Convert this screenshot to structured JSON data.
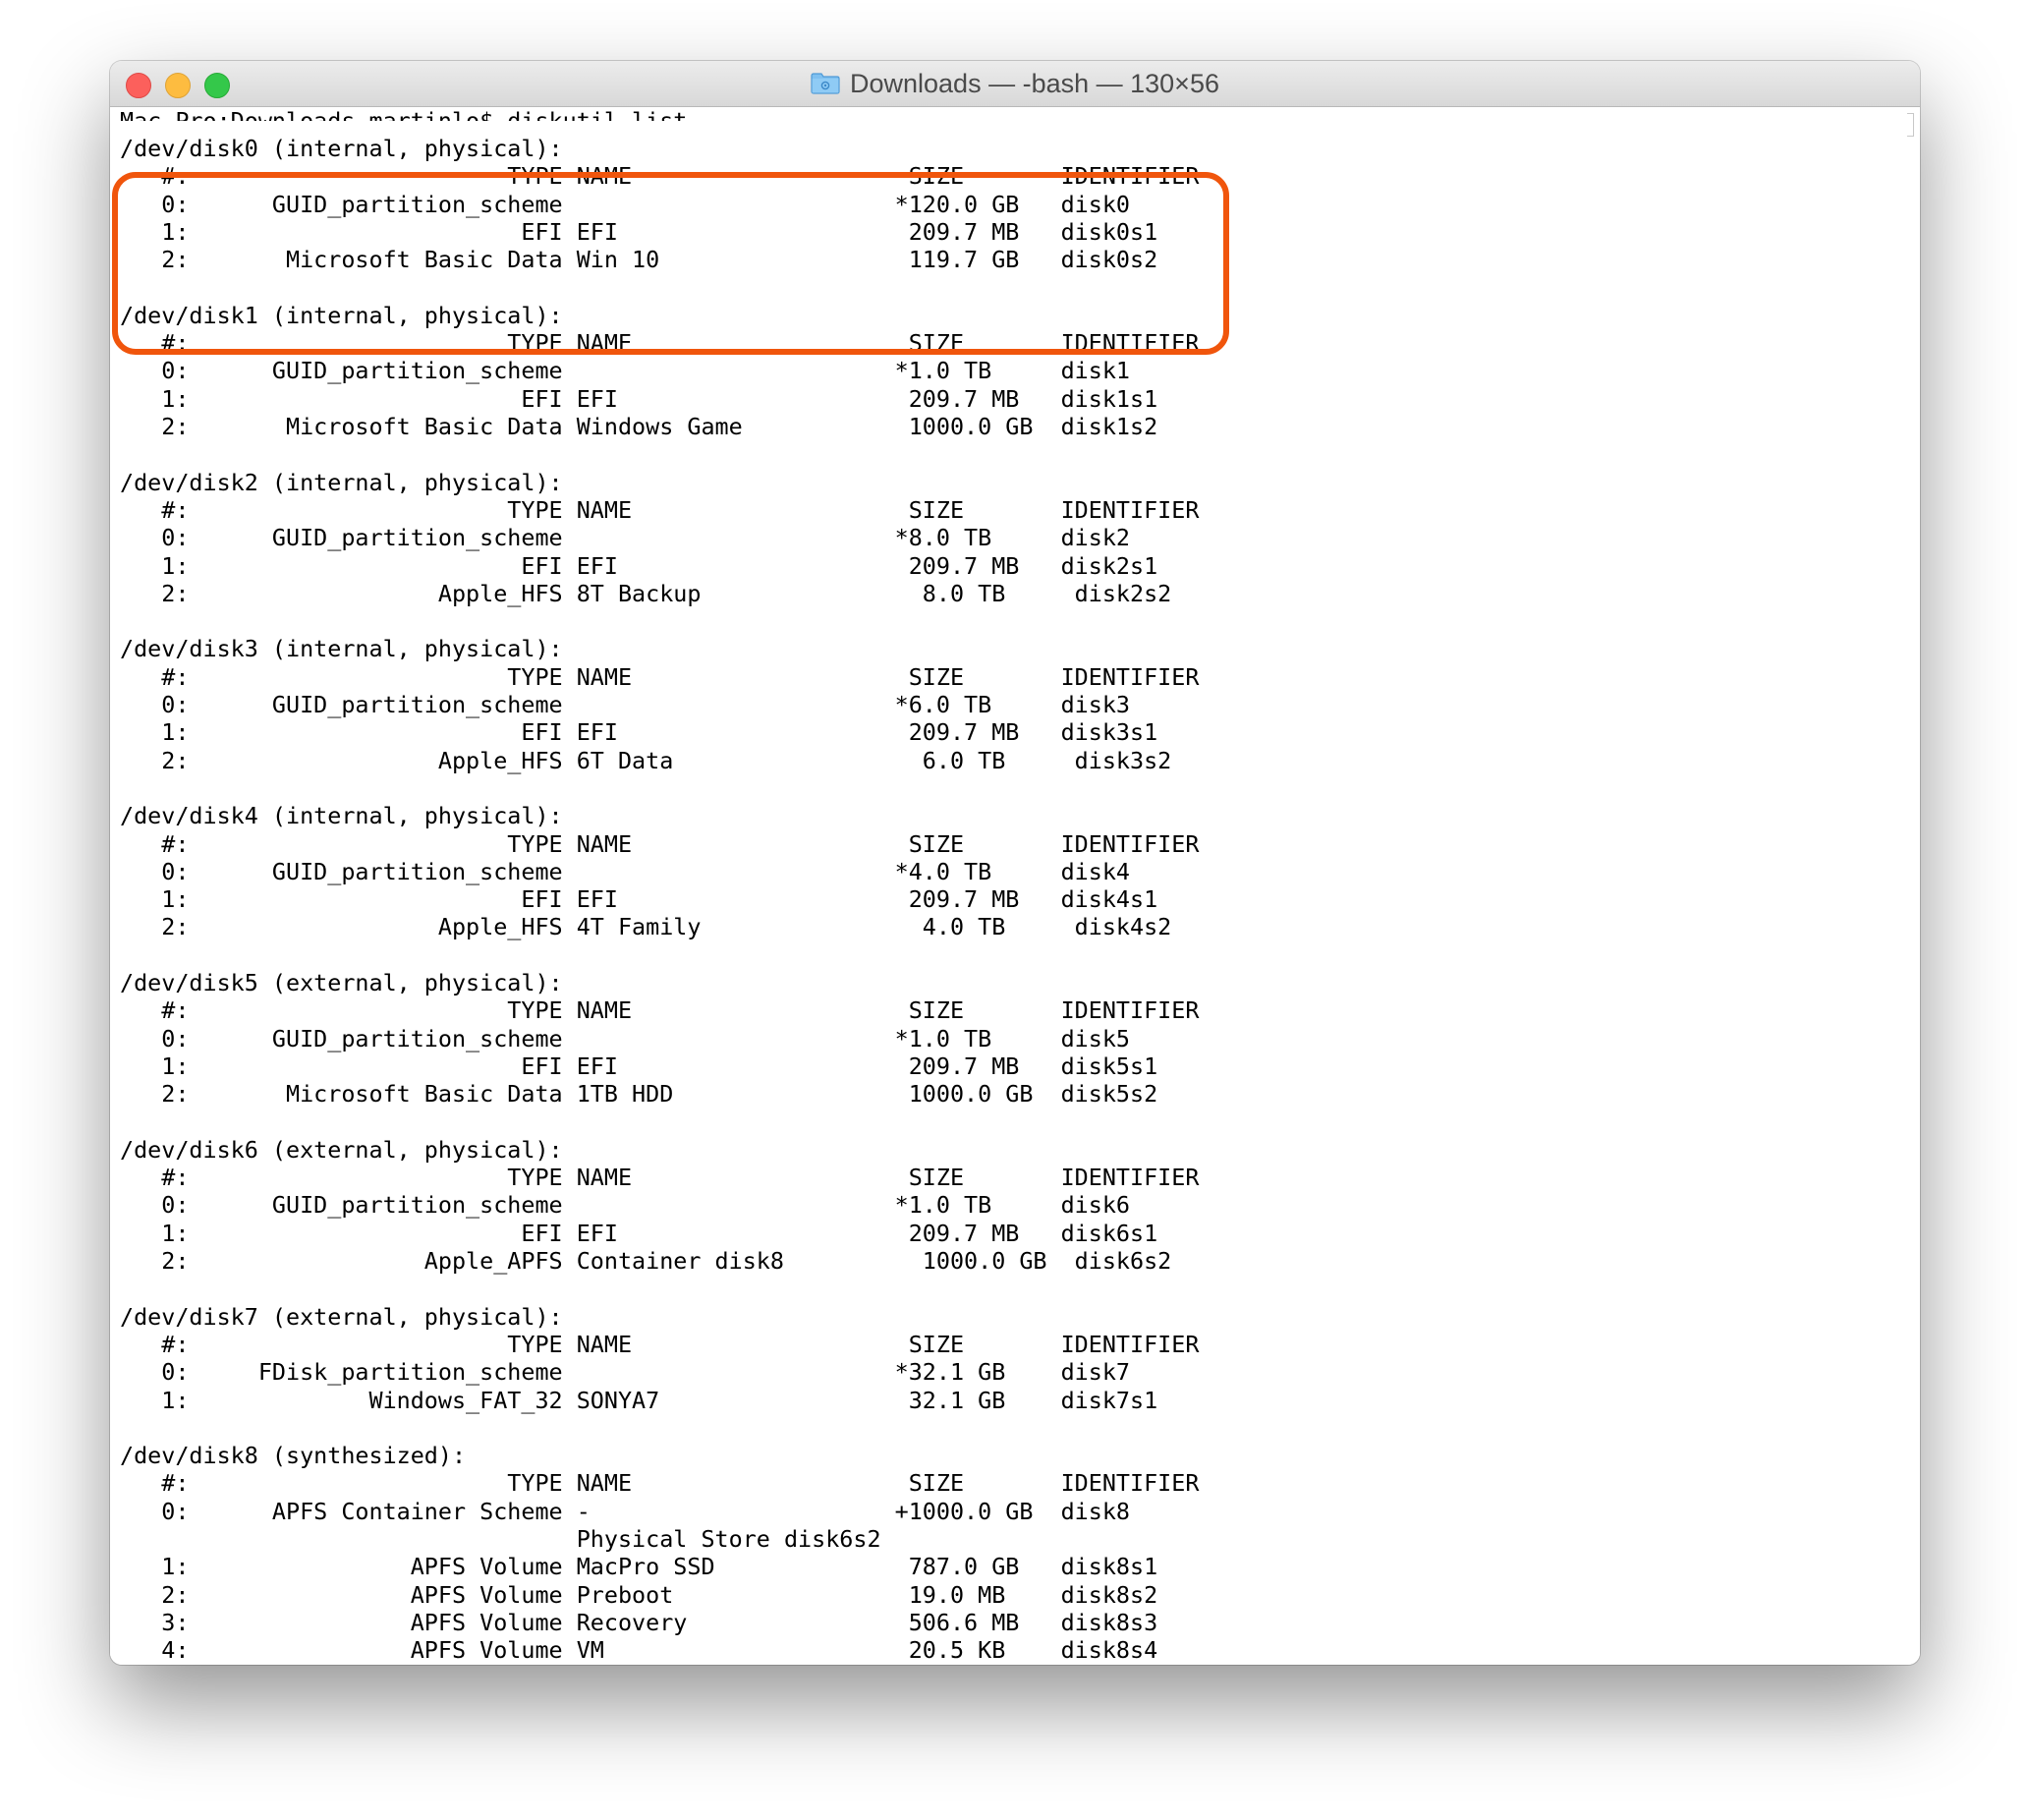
{
  "window": {
    "title": "Downloads — -bash — 130×56",
    "folder_icon": "folder-icon",
    "accent_color": "#f0550c"
  },
  "terminal": {
    "prompt": "Mac-Pro:Downloads martinlo$ diskutil list",
    "lines": [
      "/dev/disk0 (internal, physical):",
      "   #:                       TYPE NAME                    SIZE       IDENTIFIER",
      "   0:      GUID_partition_scheme                        *120.0 GB   disk0",
      "   1:                        EFI EFI                     209.7 MB   disk0s1",
      "   2:       Microsoft Basic Data Win 10                  119.7 GB   disk0s2",
      "",
      "/dev/disk1 (internal, physical):",
      "   #:                       TYPE NAME                    SIZE       IDENTIFIER",
      "   0:      GUID_partition_scheme                        *1.0 TB     disk1",
      "   1:                        EFI EFI                     209.7 MB   disk1s1",
      "   2:       Microsoft Basic Data Windows Game            1000.0 GB  disk1s2",
      "",
      "/dev/disk2 (internal, physical):",
      "   #:                       TYPE NAME                    SIZE       IDENTIFIER",
      "   0:      GUID_partition_scheme                        *8.0 TB     disk2",
      "   1:                        EFI EFI                     209.7 MB   disk2s1",
      "   2:                  Apple_HFS 8T Backup                8.0 TB     disk2s2",
      "",
      "/dev/disk3 (internal, physical):",
      "   #:                       TYPE NAME                    SIZE       IDENTIFIER",
      "   0:      GUID_partition_scheme                        *6.0 TB     disk3",
      "   1:                        EFI EFI                     209.7 MB   disk3s1",
      "   2:                  Apple_HFS 6T Data                  6.0 TB     disk3s2",
      "",
      "/dev/disk4 (internal, physical):",
      "   #:                       TYPE NAME                    SIZE       IDENTIFIER",
      "   0:      GUID_partition_scheme                        *4.0 TB     disk4",
      "   1:                        EFI EFI                     209.7 MB   disk4s1",
      "   2:                  Apple_HFS 4T Family                4.0 TB     disk4s2",
      "",
      "/dev/disk5 (external, physical):",
      "   #:                       TYPE NAME                    SIZE       IDENTIFIER",
      "   0:      GUID_partition_scheme                        *1.0 TB     disk5",
      "   1:                        EFI EFI                     209.7 MB   disk5s1",
      "   2:       Microsoft Basic Data 1TB HDD                 1000.0 GB  disk5s2",
      "",
      "/dev/disk6 (external, physical):",
      "   #:                       TYPE NAME                    SIZE       IDENTIFIER",
      "   0:      GUID_partition_scheme                        *1.0 TB     disk6",
      "   1:                        EFI EFI                     209.7 MB   disk6s1",
      "   2:                 Apple_APFS Container disk8          1000.0 GB  disk6s2",
      "",
      "/dev/disk7 (external, physical):",
      "   #:                       TYPE NAME                    SIZE       IDENTIFIER",
      "   0:     FDisk_partition_scheme                        *32.1 GB    disk7",
      "   1:             Windows_FAT_32 SONYA7                  32.1 GB    disk7s1",
      "",
      "/dev/disk8 (synthesized):",
      "   #:                       TYPE NAME                    SIZE       IDENTIFIER",
      "   0:      APFS Container Scheme -                      +1000.0 GB  disk8",
      "                                 Physical Store disk6s2",
      "   1:                APFS Volume MacPro SSD              787.0 GB   disk8s1",
      "   2:                APFS Volume Preboot                 19.0 MB    disk8s2",
      "   3:                APFS Volume Recovery                506.6 MB   disk8s3",
      "   4:                APFS Volume VM                      20.5 KB    disk8s4"
    ]
  }
}
